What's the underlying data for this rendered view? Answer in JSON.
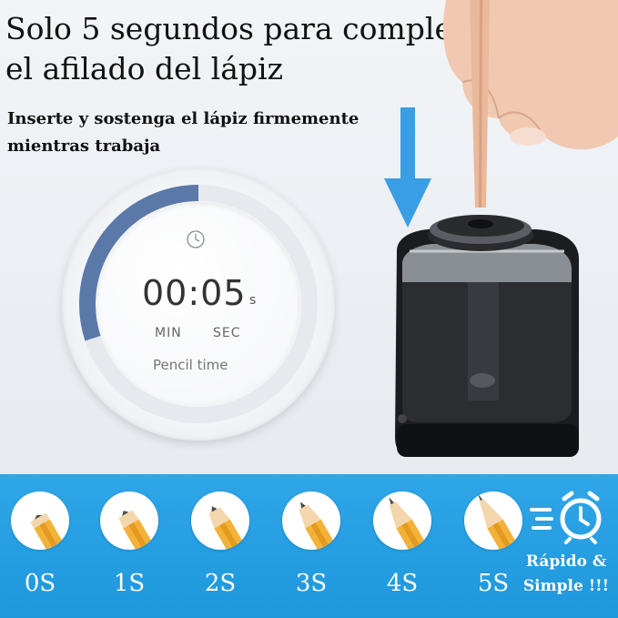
{
  "headline": "Solo 5 segundos para completar el afilado del lápiz",
  "subline": "Inserte y sostenga el lápiz firmemente mientras trabaja",
  "timer": {
    "time": "00:05",
    "unit": "s",
    "min_label": "MIN",
    "sec_label": "SEC",
    "caption": "Pencil time",
    "progress_fraction": 0.3
  },
  "steps": [
    {
      "label": "0S",
      "sharpness": 0.0
    },
    {
      "label": "1S",
      "sharpness": 0.2
    },
    {
      "label": "2S",
      "sharpness": 0.4
    },
    {
      "label": "3S",
      "sharpness": 0.6
    },
    {
      "label": "4S",
      "sharpness": 0.8
    },
    {
      "label": "5S",
      "sharpness": 1.0
    }
  ],
  "badge": {
    "line1": "Rápido &",
    "line2": "Simple !!!",
    "icon": "alarm-clock-fast-icon"
  },
  "colors": {
    "band": "#2ea6e8",
    "accent_arrow": "#3a9ee4",
    "dial_progress": "#5a78a8"
  }
}
